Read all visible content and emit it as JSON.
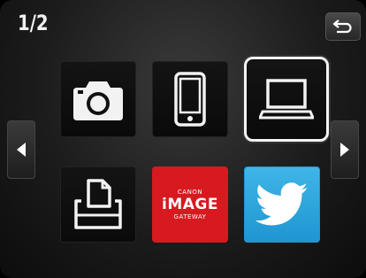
{
  "page_indicator": "1/2",
  "tiles": [
    {
      "name": "camera",
      "icon": "camera-icon"
    },
    {
      "name": "smartphone",
      "icon": "smartphone-icon"
    },
    {
      "name": "computer",
      "icon": "laptop-icon",
      "selected": true
    },
    {
      "name": "printer",
      "icon": "printer-icon"
    },
    {
      "name": "canon-image-gateway",
      "icon": "canon-image-gateway-logo",
      "logo_text": {
        "top": "CANON",
        "middle": "iMAGE",
        "bottom": "GATEWAY"
      }
    },
    {
      "name": "twitter",
      "icon": "twitter-icon"
    }
  ],
  "colors": {
    "canon_red": "#d71920",
    "twitter_blue": "#2aa3dc",
    "selection_border": "#f4f4f4"
  },
  "controls": {
    "back_icon": "return-arrow-icon",
    "prev_icon": "triangle-left-icon",
    "next_icon": "triangle-right-icon"
  }
}
